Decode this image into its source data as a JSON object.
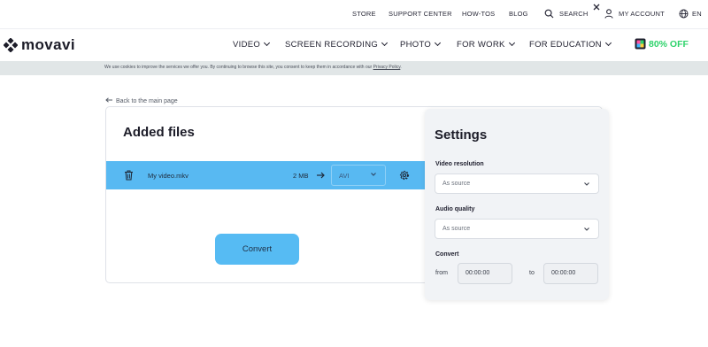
{
  "topbar": {
    "store": "STORE",
    "support": "SUPPORT CENTER",
    "howtos": "HOW-TOS",
    "blog": "BLOG",
    "search": "SEARCH",
    "account": "MY ACCOUNT",
    "lang": "EN"
  },
  "brand": {
    "name": "movavi"
  },
  "nav": {
    "items": [
      {
        "label": "VIDEO"
      },
      {
        "label": "SCREEN RECORDING"
      },
      {
        "label": "PHOTO"
      },
      {
        "label": "FOR WORK"
      },
      {
        "label": "FOR EDUCATION"
      }
    ],
    "promo": "80% OFF",
    "promo_color": "#2ed36b"
  },
  "cookie": {
    "text": "We use cookies to improve the services we offer you. By continuing to browse this site, you consent to keep them in accordance with our ",
    "link": "Privacy Policy",
    "end": "."
  },
  "back_link": "Back to the main page",
  "files": {
    "title": "Added files",
    "row": {
      "name": "My video.mkv",
      "size": "2 MB",
      "format": "AVI"
    },
    "convert_label": "Convert"
  },
  "settings": {
    "title": "Settings",
    "video_resolution": {
      "label": "Video resolution",
      "value": "As source"
    },
    "audio_quality": {
      "label": "Audio quality",
      "value": "As source"
    },
    "convert": {
      "label": "Convert",
      "from_label": "from",
      "from_value": "00:00:00",
      "to_label": "to",
      "to_value": "00:00:00"
    }
  },
  "colors": {
    "accent": "#58b9f2",
    "button": "#56bbf3",
    "cookie_bg": "#e1e6e7",
    "promo": "#2ed36b"
  },
  "icons": [
    "search-icon",
    "user-icon",
    "globe-icon",
    "trash-icon",
    "arrow-right-icon",
    "chevron-down-icon",
    "gear-icon",
    "close-icon",
    "arrow-left-icon"
  ]
}
